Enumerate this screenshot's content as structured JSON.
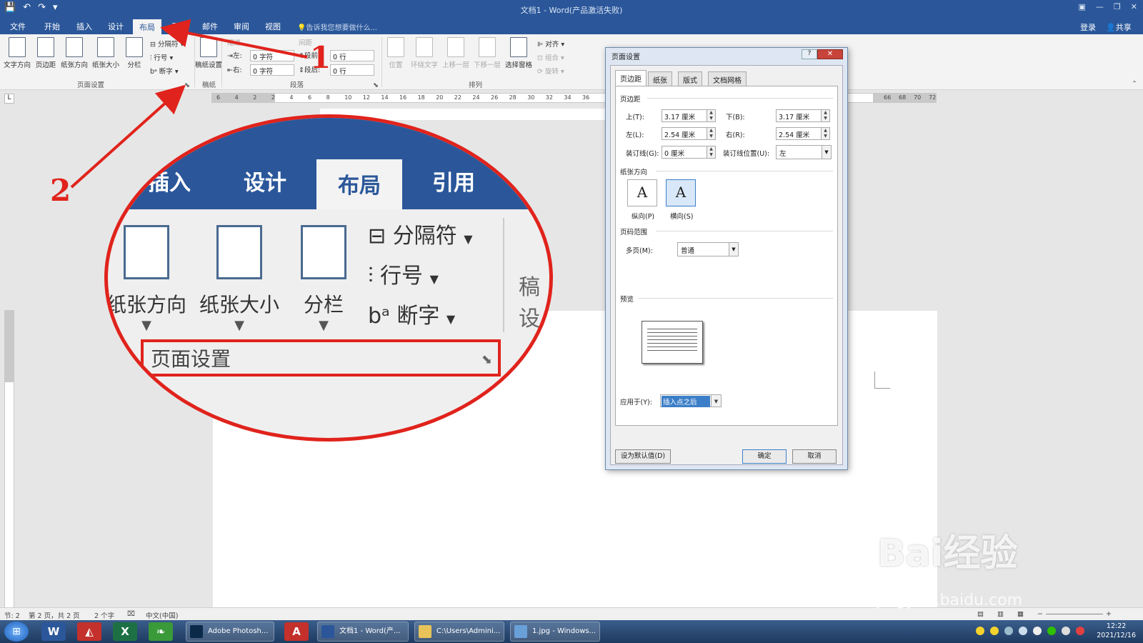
{
  "titlebar": {
    "title": "文档1 - Word(产品激活失败)"
  },
  "tabs": [
    {
      "label": "文件"
    },
    {
      "label": "开始"
    },
    {
      "label": "插入"
    },
    {
      "label": "设计"
    },
    {
      "label": "布局"
    },
    {
      "label": "引用"
    },
    {
      "label": "邮件"
    },
    {
      "label": "审阅"
    },
    {
      "label": "视图"
    }
  ],
  "tell_me": "告诉我您想要做什么...",
  "account": {
    "login": "登录",
    "share": "共享"
  },
  "ribbon": {
    "page_setup_buttons": [
      "文字方向",
      "页边距",
      "纸张方向",
      "纸张大小",
      "分栏"
    ],
    "breaks": "分隔符",
    "line_numbers": "行号",
    "hyphenation": "断字",
    "draft_paper": "稿纸设置",
    "group_page_setup": "页面设置",
    "group_draft": "稿纸",
    "indent_header": "缩进",
    "indent_left_label": "左:",
    "indent_left_value": "0 字符",
    "indent_right_label": "右:",
    "indent_right_value": "0 字符",
    "spacing_header": "间距",
    "spacing_before_label": "段前:",
    "spacing_before_value": "0 行",
    "spacing_after_label": "段后:",
    "spacing_after_value": "0 行",
    "group_paragraph": "段落",
    "arrange_buttons": [
      "位置",
      "环绕文字",
      "上移一层",
      "下移一层",
      "选择窗格"
    ],
    "align": "对齐",
    "group_btn": "组合",
    "rotate": "旋转",
    "group_arrange": "排列"
  },
  "ruler_ticks": [
    "6",
    "4",
    "2",
    "2",
    "4",
    "6",
    "8",
    "10",
    "12",
    "14",
    "16",
    "18",
    "20",
    "22",
    "24",
    "26",
    "28",
    "30",
    "32",
    "34",
    "36",
    "66",
    "68",
    "70",
    "72"
  ],
  "magnifier": {
    "tabs": [
      "插入",
      "设计",
      "布局",
      "引用"
    ],
    "buttons": [
      "纸张方向",
      "纸张大小",
      "分栏"
    ],
    "rows": [
      "分隔符",
      "行号",
      "断字"
    ],
    "group_label": "页面设置",
    "edge_text": "稿设"
  },
  "annotations": {
    "num1": "1",
    "num2": "2"
  },
  "dialog": {
    "title": "页面设置",
    "help": "?",
    "close": "✕",
    "tabs": [
      "页边距",
      "纸张",
      "版式",
      "文档网格"
    ],
    "section_margins": "页边距",
    "top_label": "上(T):",
    "top_value": "3.17 厘米",
    "bottom_label": "下(B):",
    "bottom_value": "3.17 厘米",
    "left_label": "左(L):",
    "left_value": "2.54 厘米",
    "right_label": "右(R):",
    "right_value": "2.54 厘米",
    "gutter_label": "装订线(G):",
    "gutter_value": "0 厘米",
    "gutter_pos_label": "装订线位置(U):",
    "gutter_pos_value": "左",
    "section_orientation": "纸张方向",
    "portrait": "纵向(P)",
    "landscape": "横向(S)",
    "section_pages": "页码范围",
    "multi_pages_label": "多页(M):",
    "multi_pages_value": "普通",
    "section_preview": "预览",
    "apply_label": "应用于(Y):",
    "apply_value": "插入点之后",
    "default_button": "设为默认值(D)",
    "ok": "确定",
    "cancel": "取消"
  },
  "status": {
    "section": "节: 2",
    "page": "第 2 页，共 2 页",
    "words": "2 个字",
    "lang": "中文(中国)"
  },
  "taskbar": {
    "tasks": [
      "Adobe Photosh...",
      "文档1 - Word(产...",
      "C:\\Users\\Admini...",
      "1.jpg - Windows..."
    ],
    "time": "12:22",
    "date": "2021/12/16"
  },
  "watermark": {
    "brand": "Bai经验",
    "url": "jingyan.baidu.com"
  },
  "colors": {
    "word_blue": "#2b579a",
    "annotation_red": "#e0231c",
    "highlight": "#3c7fc8"
  }
}
